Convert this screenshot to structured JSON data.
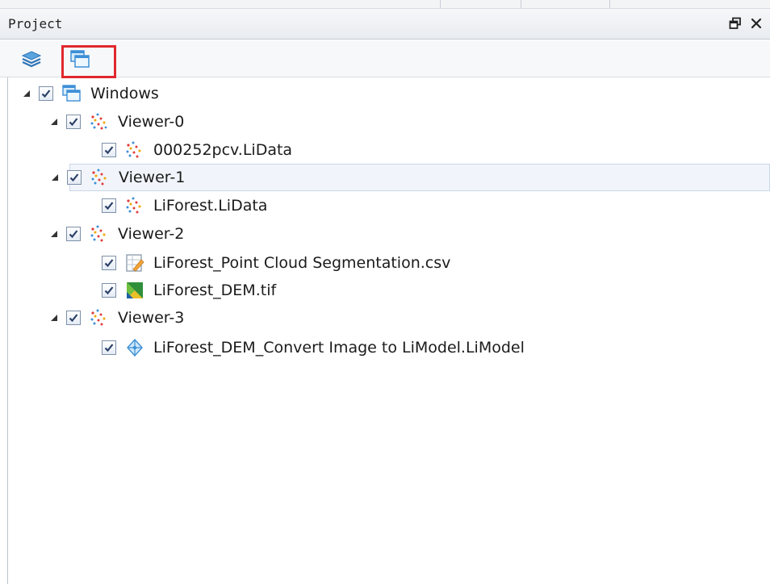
{
  "panel": {
    "title": "Project",
    "controls": {
      "float_icon": "float-window-icon",
      "close_icon": "close-icon"
    }
  },
  "toolbar": {
    "buttons": [
      {
        "icon": "layers-icon",
        "selected": false
      },
      {
        "icon": "windows-view-icon",
        "selected": true
      }
    ],
    "highlight_color": "#e0282d"
  },
  "tree": {
    "root": {
      "label": "Windows",
      "icon": "windows-icon",
      "checked": true,
      "expanded": true
    },
    "viewers": [
      {
        "label": "Viewer-0",
        "icon": "point-cloud-icon",
        "checked": true,
        "expanded": true,
        "children": [
          {
            "label": "000252pcv.LiData",
            "icon": "point-cloud-icon",
            "checked": true
          }
        ]
      },
      {
        "label": "Viewer-1",
        "icon": "point-cloud-icon",
        "checked": true,
        "expanded": true,
        "selected": true,
        "children": [
          {
            "label": "LiForest.LiData",
            "icon": "point-cloud-icon",
            "checked": true
          }
        ]
      },
      {
        "label": "Viewer-2",
        "icon": "point-cloud-icon",
        "checked": true,
        "expanded": true,
        "children": [
          {
            "label": "LiForest_Point Cloud Segmentation.csv",
            "icon": "table-file-icon",
            "checked": true
          },
          {
            "label": "LiForest_DEM.tif",
            "icon": "raster-image-icon",
            "checked": true
          }
        ]
      },
      {
        "label": "Viewer-3",
        "icon": "point-cloud-icon",
        "checked": true,
        "expanded": true,
        "children": [
          {
            "label": "LiForest_DEM_Convert Image to LiModel.LiModel",
            "icon": "model-icon",
            "checked": true
          }
        ]
      }
    ]
  }
}
